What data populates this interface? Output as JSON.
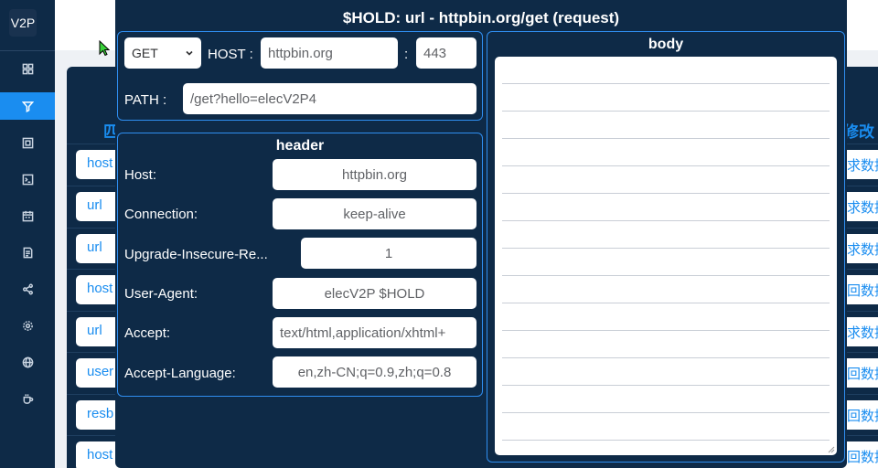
{
  "app": {
    "logo": "V2P"
  },
  "nav": {
    "items": [
      "dashboard-icon",
      "filter-icon",
      "task-icon",
      "terminal-icon",
      "calendar-icon",
      "document-icon",
      "share-icon",
      "gear-icon",
      "globe-icon",
      "coffee-icon"
    ],
    "active_index": 1
  },
  "background": {
    "col_left_head": "匹",
    "col_right_head": "修改",
    "left_cells": [
      "host",
      "url",
      "url",
      "host",
      "url",
      "user",
      "resb",
      "host"
    ],
    "right_cells": [
      "求数据",
      "求数据",
      "求数据",
      "回数据",
      "求数据",
      "回数据",
      "回数据",
      "回数据"
    ]
  },
  "modal": {
    "title": "$HOLD: url - httpbin.org/get (request)",
    "request": {
      "method": "GET",
      "host_label": "HOST :",
      "host": "httpbin.org",
      "port_sep": ":",
      "port": "443",
      "path_label": "PATH :",
      "path": "/get?hello=elecV2P4"
    },
    "header": {
      "title": "header",
      "rows": [
        {
          "key": "Host:",
          "value": "httpbin.org"
        },
        {
          "key": "Connection:",
          "value": "keep-alive"
        },
        {
          "key": "Upgrade-Insecure-Re...",
          "value": "1"
        },
        {
          "key": "User-Agent:",
          "value": "elecV2P $HOLD"
        },
        {
          "key": "Accept:",
          "value": "text/html,application/xhtml+"
        },
        {
          "key": "Accept-Language:",
          "value": "en,zh-CN;q=0.9,zh;q=0.8"
        }
      ]
    },
    "body": {
      "title": "body",
      "value": ""
    }
  },
  "colors": {
    "navy": "#0e2a47",
    "accent": "#1a8df0",
    "panel_border": "#2f8ef0"
  }
}
